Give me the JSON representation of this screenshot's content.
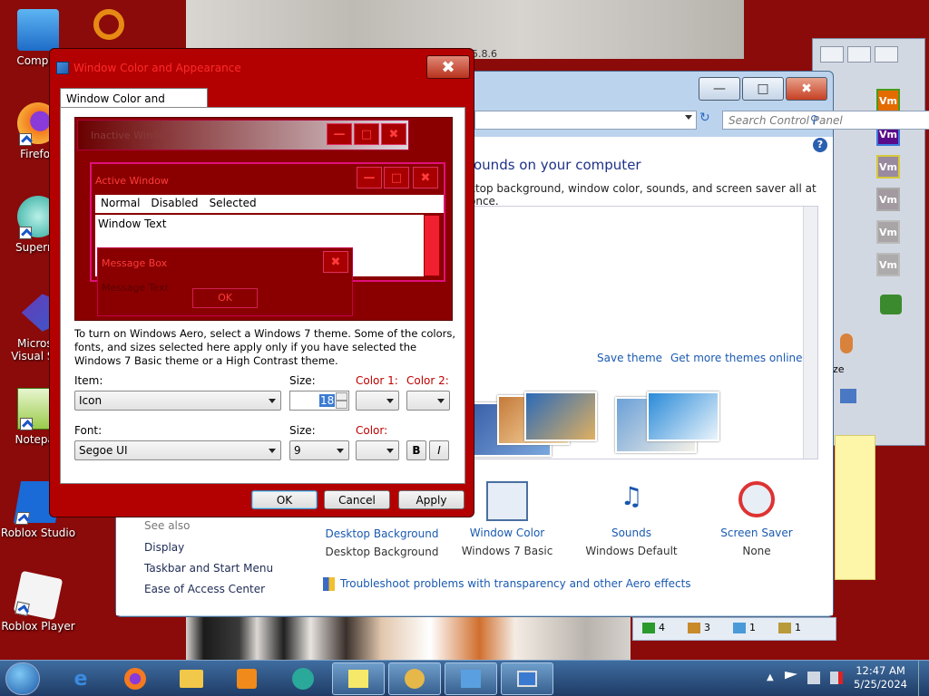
{
  "desktop": {
    "icons": [
      {
        "label": "Comput",
        "icon": "computer-icon"
      },
      {
        "label": "Firefox",
        "icon": "firefox-icon"
      },
      {
        "label": "Supermi",
        "icon": "supermium-icon"
      },
      {
        "label": "Microso Visual Stu",
        "icon": "visual-studio-icon"
      },
      {
        "label": "Notepad",
        "icon": "notepad-icon"
      },
      {
        "label": "Roblox Studio",
        "icon": "roblox-studio-icon"
      },
      {
        "label": "Roblox Player",
        "icon": "roblox-player-icon"
      }
    ]
  },
  "background_window": {
    "version_fragment": "5.8.6",
    "search_placeholder": "Search Control Panel",
    "heading": "ounds on your computer",
    "subheading": "ktop background, window color, sounds, and screen saver all at once.",
    "save_theme": "Save theme",
    "get_more_themes": "Get more themes online",
    "see_also": "See also",
    "left_links": [
      "Display",
      "Taskbar and Start Menu",
      "Ease of Access Center"
    ],
    "bottom_items": [
      {
        "label": "Desktop Background",
        "value": "Desktop Background"
      },
      {
        "label": "Window Color",
        "value": "Windows 7 Basic"
      },
      {
        "label": "Sounds",
        "value": "Windows Default"
      },
      {
        "label": "Screen Saver",
        "value": "None"
      }
    ],
    "troubleshoot": "Troubleshoot problems with transparency and other Aero effects"
  },
  "right_window": {
    "vm_label": "Vm",
    "size_fragment": "ze"
  },
  "dialog": {
    "title": "Window Color and Appearance",
    "tab": "Window Color and Appearance",
    "preview": {
      "inactive": "Inactive Window",
      "active": "Active Window",
      "menu": [
        "Normal",
        "Disabled",
        "Selected"
      ],
      "window_text": "Window Text",
      "message_box": "Message Box",
      "message_text": "Message Text",
      "ok": "OK"
    },
    "hint": "To turn on Windows Aero, select a Windows 7 theme.  Some of the colors, fonts, and sizes selected here apply only if you have selected the Windows 7 Basic theme or a High Contrast theme.",
    "item_label": "Item:",
    "item_value": "Icon",
    "size_label": "Size:",
    "size_value": "18",
    "color1_label": "Color 1:",
    "color2_label": "Color 2:",
    "font_label": "Font:",
    "font_value": "Segoe UI",
    "font_size_label": "Size:",
    "font_size_value": "9",
    "font_color_label": "Color:",
    "bold": "B",
    "italic": "I",
    "ok": "OK",
    "cancel": "Cancel",
    "apply": "Apply"
  },
  "status_strip": [
    "4",
    "3",
    "1",
    "1"
  ],
  "taskbar": {
    "time": "12:47 AM",
    "date": "5/25/2024"
  },
  "colors": {
    "desktop": "#8b0a0a",
    "dialog_frame": "#b30000",
    "title_text": "#ff2b2b",
    "link": "#1a5ab0"
  }
}
